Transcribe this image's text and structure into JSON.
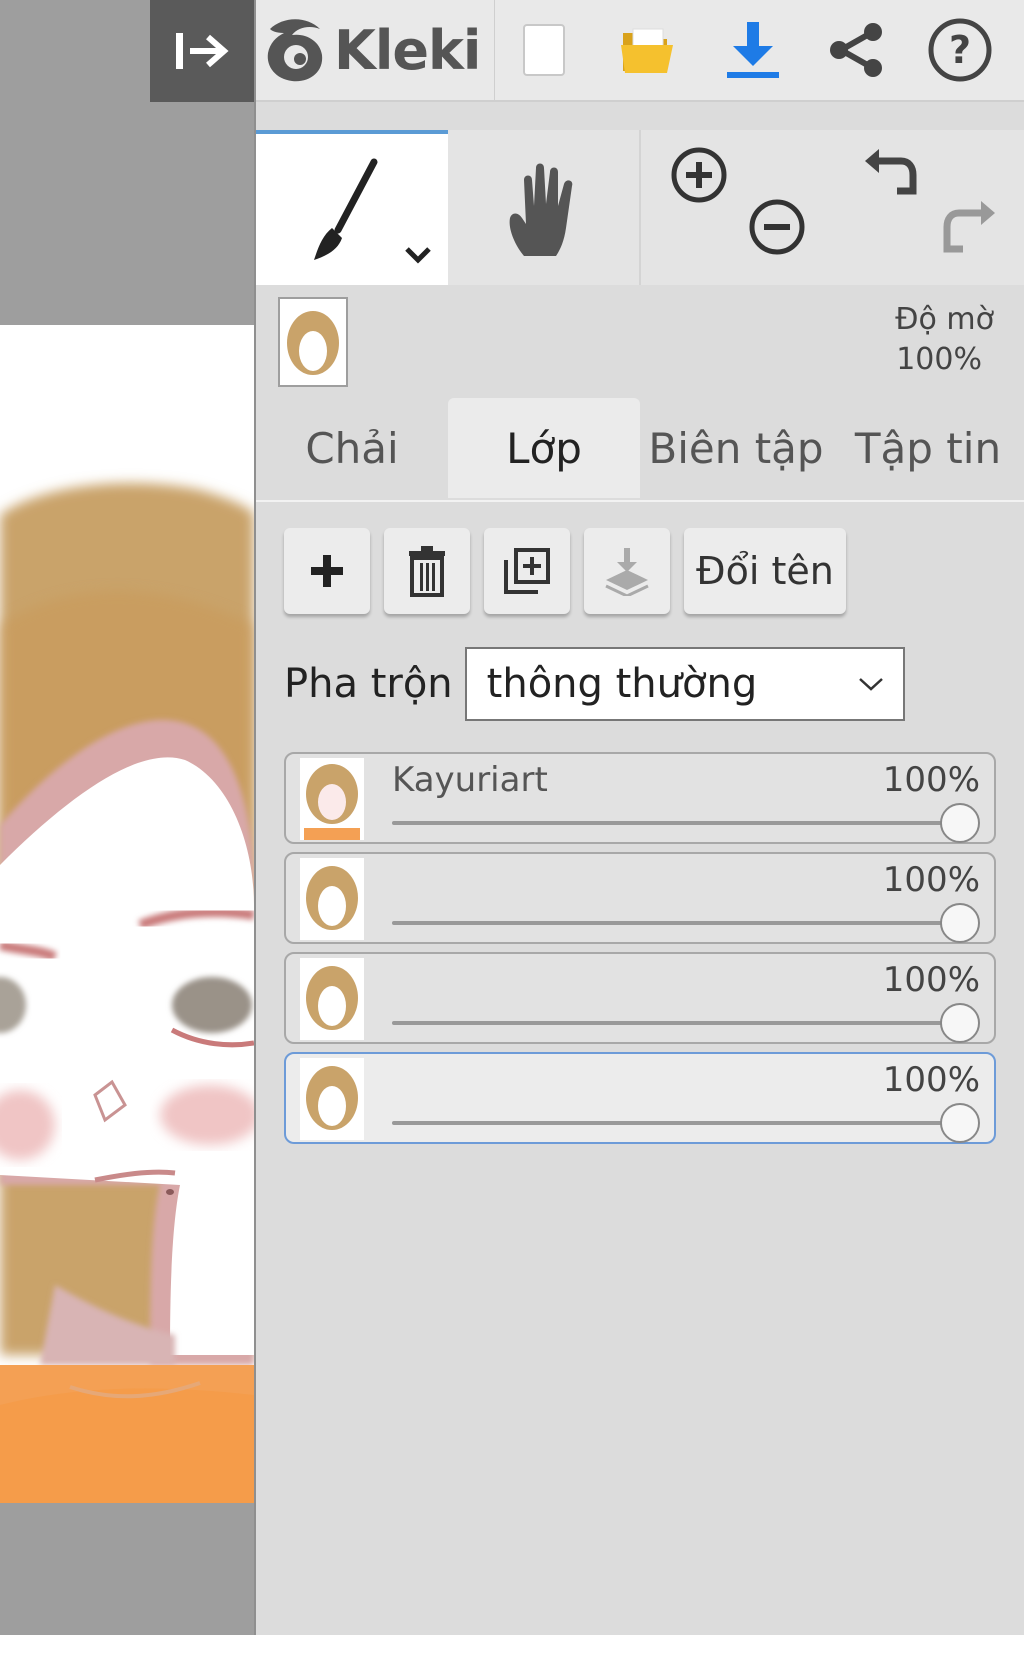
{
  "app": {
    "name": "Kleki",
    "accent_color": "#1e7be6"
  },
  "topbar": {
    "collapse_icon": "arrow-right-to-line-icon",
    "icons": [
      "new-document-icon",
      "open-folder-icon",
      "download-icon",
      "share-icon",
      "help-icon"
    ]
  },
  "tools": {
    "active": "brush",
    "items": [
      "brush-icon",
      "hand-icon",
      "zoom-in-icon",
      "zoom-out-icon",
      "undo-icon",
      "redo-icon"
    ]
  },
  "preview": {
    "opacity_label": "Độ mờ",
    "opacity_value": "100%"
  },
  "tabs": [
    {
      "label": "Chải",
      "active": false
    },
    {
      "label": "Lớp",
      "active": true
    },
    {
      "label": "Biên tập",
      "active": false
    },
    {
      "label": "Tập tin",
      "active": false
    }
  ],
  "layer_toolbar": {
    "buttons": [
      "add-layer-icon",
      "delete-layer-icon",
      "duplicate-layer-icon",
      "merge-down-icon"
    ],
    "rename_label": "Đổi tên"
  },
  "blend": {
    "label": "Pha trộn",
    "value": "thông thường"
  },
  "layers": [
    {
      "name": "Kayuriart",
      "opacity": "100%",
      "opacity_fraction": 1.0,
      "active": false
    },
    {
      "name": "",
      "opacity": "100%",
      "opacity_fraction": 1.0,
      "active": false
    },
    {
      "name": "",
      "opacity": "100%",
      "opacity_fraction": 1.0,
      "active": false
    },
    {
      "name": "",
      "opacity": "100%",
      "opacity_fraction": 1.0,
      "active": true
    }
  ]
}
